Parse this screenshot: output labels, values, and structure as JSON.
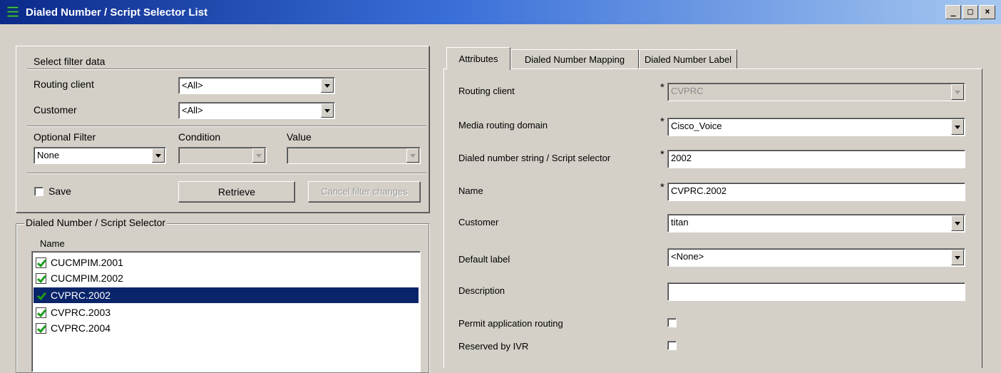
{
  "window": {
    "title": "Dialed Number / Script Selector List",
    "minimize": "_",
    "maximize": "□",
    "close": "×"
  },
  "filter": {
    "group_title": "Select filter data",
    "routing_client_label": "Routing client",
    "routing_client_value": "<All>",
    "customer_label": "Customer",
    "customer_value": "<All>",
    "optional_filter_label": "Optional Filter",
    "condition_label": "Condition",
    "value_label": "Value",
    "optional_filter_value": "None",
    "save_label": "Save",
    "retrieve_label": "Retrieve",
    "cancel_label": "Cancel filter changes"
  },
  "list_panel": {
    "group_title": "Dialed Number / Script Selector",
    "column_header": "Name",
    "items": [
      {
        "name": "CUCMPIM.2001",
        "selected": false
      },
      {
        "name": "CUCMPIM.2002",
        "selected": false
      },
      {
        "name": "CVPRC.2002",
        "selected": true
      },
      {
        "name": "CVPRC.2003",
        "selected": false
      },
      {
        "name": "CVPRC.2004",
        "selected": false
      }
    ]
  },
  "tabs": [
    {
      "label": "Attributes",
      "active": true
    },
    {
      "label": "Dialed Number Mapping",
      "active": false
    },
    {
      "label": "Dialed Number Label",
      "active": false
    }
  ],
  "attributes": {
    "required_mark": "*",
    "routing_client_label": "Routing client",
    "routing_client_value": "CVPRC",
    "media_routing_domain_label": "Media routing domain",
    "media_routing_domain_value": "Cisco_Voice",
    "dialed_number_string_label": "Dialed number string / Script selector",
    "dialed_number_string_value": "2002",
    "name_label": "Name",
    "name_value": "CVPRC.2002",
    "customer_label": "Customer",
    "customer_value": "titan",
    "default_label_label": "Default label",
    "default_label_value": "<None>",
    "description_label": "Description",
    "description_value": "",
    "permit_app_routing_label": "Permit application routing",
    "reserved_by_ivr_label": "Reserved by IVR"
  },
  "colors": {
    "face": "#d4d0c8",
    "selection": "#0a246a",
    "check": "#1d9c1d"
  }
}
